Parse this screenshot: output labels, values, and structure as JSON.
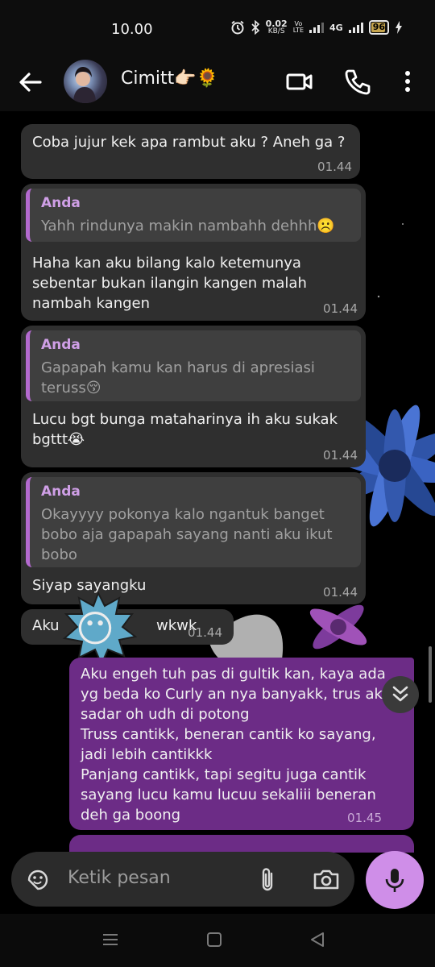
{
  "status_bar": {
    "time": "10.00",
    "net_speed_value": "0.02",
    "net_speed_unit": "KB/S",
    "volte_top": "Vo",
    "volte_bottom": "LTE",
    "network": "4G",
    "battery": "96"
  },
  "header": {
    "contact_name": "Cimitt👉🏻🌻",
    "icons": [
      "back-arrow-icon",
      "video-call-icon",
      "phone-icon",
      "more-options-icon"
    ]
  },
  "messages": [
    {
      "type": "in",
      "text": "Coba jujur kek apa rambut aku ? Aneh ga ?",
      "time": "01.44"
    },
    {
      "type": "in",
      "quote_name": "Anda",
      "quote_text": "Yahh rindunya makin nambahh dehhh☹️",
      "text_lines": [
        "Haha kan aku bilang kalo ketemunya",
        "sebentar bukan ilangin kangen malah",
        "nambah kangen"
      ],
      "time": "01.44"
    },
    {
      "type": "in",
      "quote_name": "Anda",
      "quote_lines": [
        "Gapapah kamu kan harus di apresiasi",
        "teruss😚"
      ],
      "text_lines": [
        "Lucu bgt bunga mataharinya ih aku sukak",
        "bgttt😭"
      ],
      "time": "01.44"
    },
    {
      "type": "in",
      "quote_name": "Anda",
      "quote_lines": [
        "Okayyyy pokonya kalo ngantuk banget",
        "bobo aja gapapah sayang nanti aku ikut",
        "bobo"
      ],
      "text": "Siyap sayangku",
      "time": "01.44"
    },
    {
      "type": "in",
      "text_start": "Aku",
      "text_end": "wkwk",
      "sticker": "😶",
      "time": "01.44"
    },
    {
      "type": "out",
      "text_lines": [
        "Aku engeh tuh pas di gultik kan, kaya ada",
        "yg beda ko Curly an nya banyakk, trus aku",
        "sadar oh udh di potong",
        "Truss cantikk, beneran cantik ko sayang,",
        "jadi lebih cantikkk",
        "Panjang cantikk, tapi segitu juga cantik",
        "sayang lucu kamu lucuu sekaliii beneran",
        "deh ga boong"
      ],
      "time": "01.45"
    }
  ],
  "input": {
    "placeholder": "Ketik pesan",
    "icons": [
      "sticker-icon",
      "attach-icon",
      "camera-icon",
      "mic-icon"
    ]
  },
  "nav_icons": [
    "recents-icon",
    "home-icon",
    "back-icon"
  ]
}
